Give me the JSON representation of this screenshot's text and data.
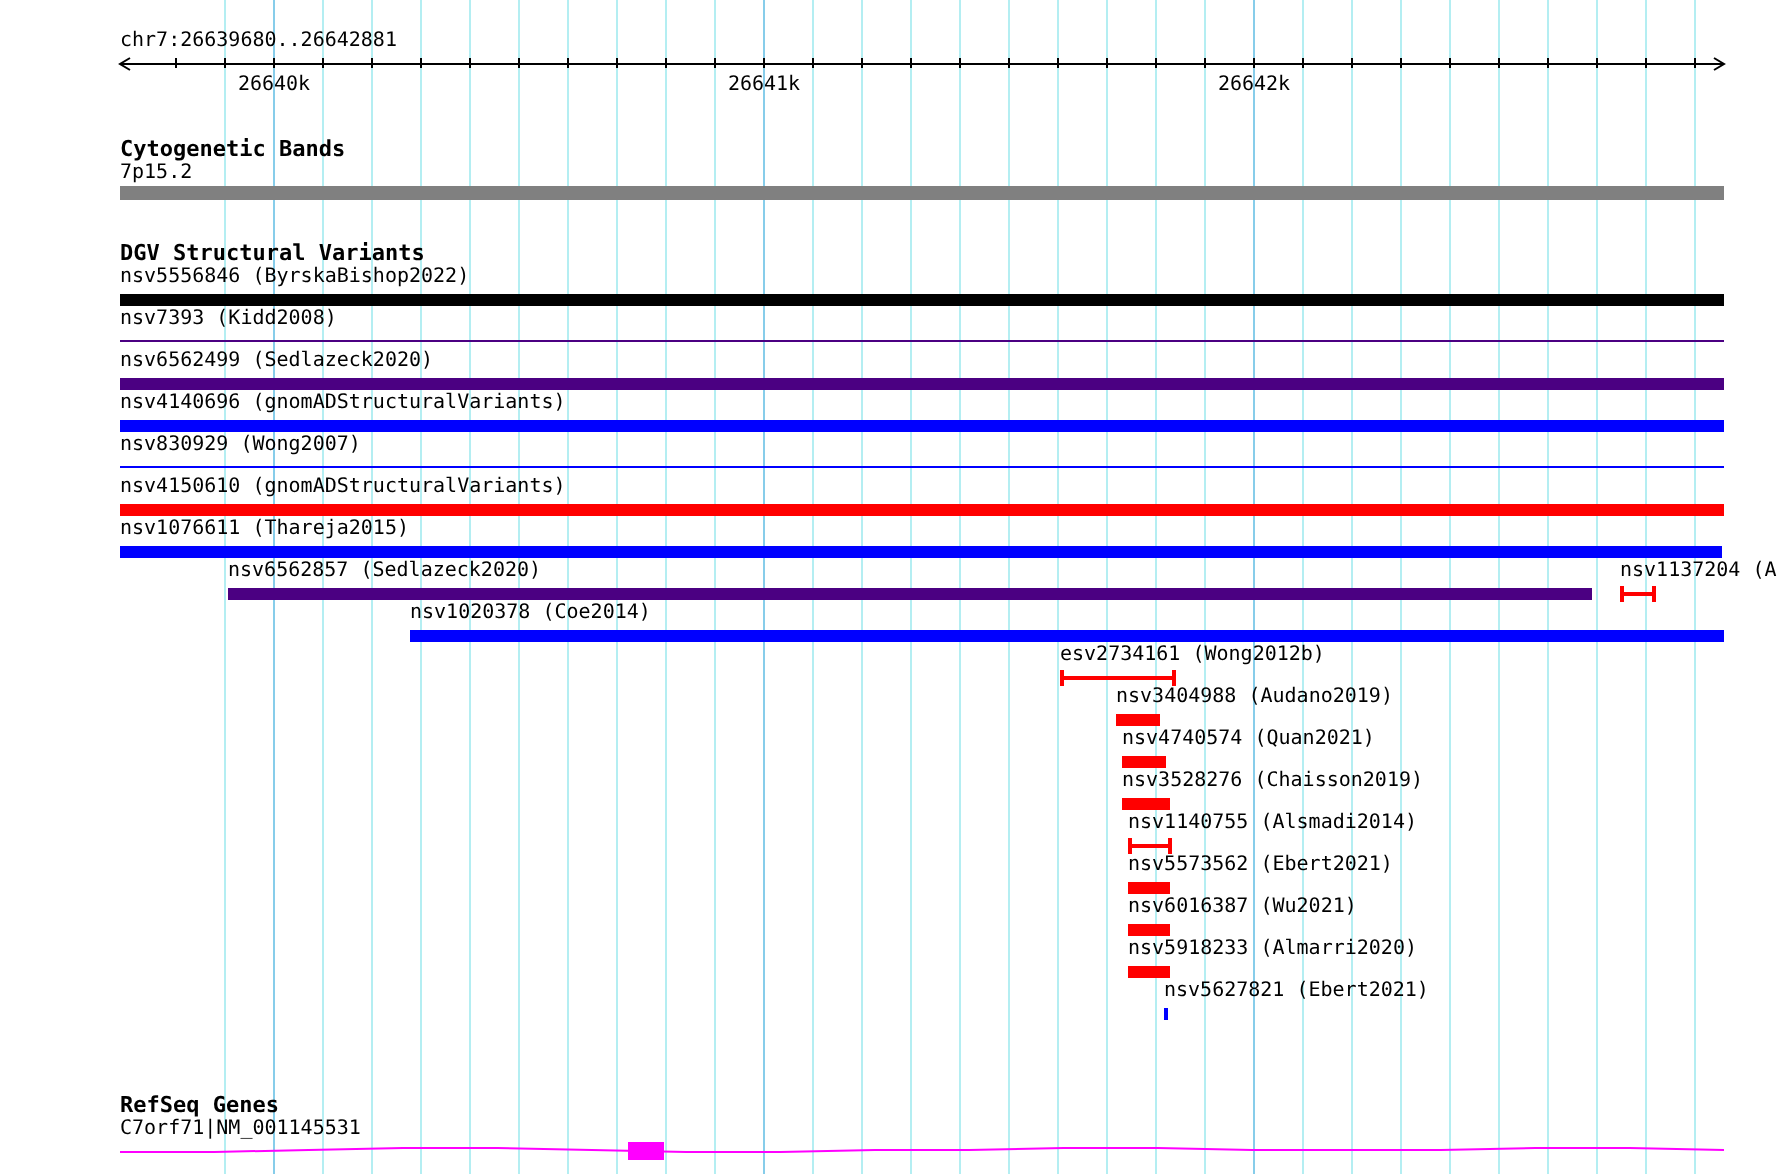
{
  "location": "chr7:26639680..26642881",
  "ticks": [
    {
      "label": "26640k"
    },
    {
      "label": "26641k"
    },
    {
      "label": "26642k"
    }
  ],
  "cytoband_track": {
    "title": "Cytogenetic Bands",
    "band": {
      "label": "7p15.2"
    }
  },
  "variant_track": {
    "title": "DGV Structural Variants",
    "rows": [
      [
        {
          "label": "nsv5556846 (ByrskaBishop2022)",
          "kind": "bar",
          "color": "#000000"
        }
      ],
      [
        {
          "label": "nsv7393 (Kidd2008)",
          "kind": "line",
          "color": "#4b0082"
        }
      ],
      [
        {
          "label": "nsv6562499 (Sedlazeck2020)",
          "kind": "bar",
          "color": "#4b0082"
        }
      ],
      [
        {
          "label": "nsv4140696 (gnomADStructuralVariants)",
          "kind": "bar",
          "color": "#0000ff"
        }
      ],
      [
        {
          "label": "nsv830929 (Wong2007)",
          "kind": "line",
          "color": "#0000ff"
        }
      ],
      [
        {
          "label": "nsv4150610 (gnomADStructuralVariants)",
          "kind": "bar",
          "color": "#ff0000"
        }
      ],
      [
        {
          "label": "nsv1076611 (Thareja2015)",
          "kind": "bar",
          "color": "#0000ff"
        }
      ],
      [
        {
          "label": "nsv6562857 (Sedlazeck2020)",
          "kind": "bar",
          "color": "#4b0082"
        },
        {
          "label": "nsv1137204 (A",
          "kind": "interval",
          "color": "#ff0000"
        }
      ],
      [
        {
          "label": "nsv1020378 (Coe2014)",
          "kind": "bar",
          "color": "#0000ff"
        }
      ],
      [
        {
          "label": "esv2734161 (Wong2012b)",
          "kind": "interval",
          "color": "#ff0000"
        }
      ],
      [
        {
          "label": "nsv3404988 (Audano2019)",
          "kind": "bar",
          "color": "#ff0000"
        }
      ],
      [
        {
          "label": "nsv4740574 (Quan2021)",
          "kind": "bar",
          "color": "#ff0000"
        }
      ],
      [
        {
          "label": "nsv3528276 (Chaisson2019)",
          "kind": "bar",
          "color": "#ff0000"
        }
      ],
      [
        {
          "label": "nsv1140755 (Alsmadi2014)",
          "kind": "interval",
          "color": "#ff0000"
        }
      ],
      [
        {
          "label": "nsv5573562 (Ebert2021)",
          "kind": "bar",
          "color": "#ff0000"
        }
      ],
      [
        {
          "label": "nsv6016387 (Wu2021)",
          "kind": "bar",
          "color": "#ff0000"
        }
      ],
      [
        {
          "label": "nsv5918233 (Almarri2020)",
          "kind": "bar",
          "color": "#ff0000"
        }
      ],
      [
        {
          "label": "nsv5627821 (Ebert2021)",
          "kind": "bar",
          "color": "#0000ff"
        }
      ]
    ]
  },
  "gene_track": {
    "title": "RefSeq Genes",
    "gene": {
      "label": "C7orf71|NM_001145531"
    }
  }
}
